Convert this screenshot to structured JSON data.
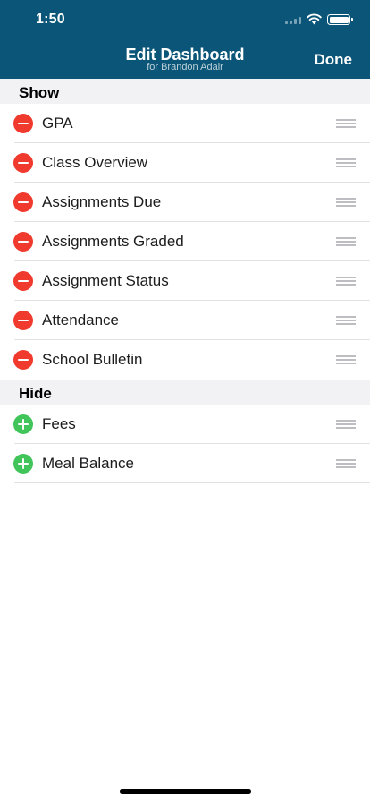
{
  "status_bar": {
    "time": "1:50"
  },
  "nav": {
    "title": "Edit Dashboard",
    "subtitle": "for Brandon Adair",
    "done_label": "Done",
    "background": "#0b5678"
  },
  "sections": {
    "show": {
      "header": "Show",
      "items": [
        {
          "label": "GPA"
        },
        {
          "label": "Class Overview"
        },
        {
          "label": "Assignments Due"
        },
        {
          "label": "Assignments Graded"
        },
        {
          "label": "Assignment Status"
        },
        {
          "label": "Attendance"
        },
        {
          "label": "School Bulletin"
        }
      ]
    },
    "hide": {
      "header": "Hide",
      "items": [
        {
          "label": "Fees"
        },
        {
          "label": "Meal Balance"
        }
      ]
    }
  },
  "icons": {
    "remove": "minus-circle-icon",
    "add": "plus-circle-icon",
    "reorder": "reorder-grip-icon",
    "remove_color": "#f03a2e",
    "add_color": "#41c45a"
  }
}
